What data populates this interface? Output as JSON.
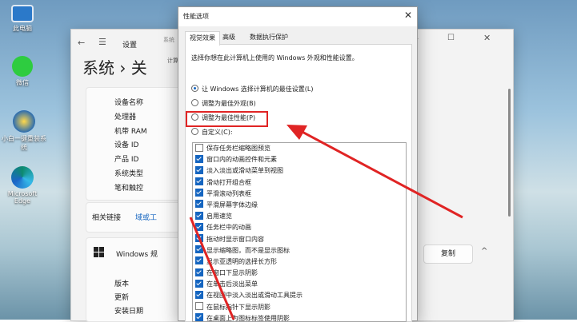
{
  "desktop": {
    "icons": [
      {
        "label": "此电脑",
        "icon": "computer-icon"
      },
      {
        "label": "微信",
        "icon": "wechat-icon"
      },
      {
        "label": "小白一键重装系统",
        "icon": "xiaobai-icon"
      },
      {
        "label": "Microsoft Edge",
        "icon": "edge-icon"
      }
    ]
  },
  "settings": {
    "app_title": "设置",
    "page_title": "系统 › 关",
    "partial_tab": "系统",
    "partial_tab2": "计算",
    "spec_labels": [
      "设备名称",
      "处理器",
      "机带 RAM",
      "设备 ID",
      "产品 ID",
      "系统类型",
      "笔和触控"
    ],
    "related_links_label": "相关链接",
    "related_link": "域或工",
    "windows_spec_label": "Windows 规",
    "copy_button": "复制",
    "win_spec_labels": [
      "版本",
      "更新",
      "安装日期"
    ]
  },
  "dialog": {
    "title": "性能选项",
    "tabs": [
      "视觉效果",
      "高级",
      "数据执行保护"
    ],
    "description": "选择你想在此计算机上使用的 Windows 外观和性能设置。",
    "radios": [
      {
        "label": "让 Windows 选择计算机的最佳设置(L)",
        "checked": true
      },
      {
        "label": "调整为最佳外观(B)",
        "checked": false
      },
      {
        "label": "调整为最佳性能(P)",
        "checked": false,
        "highlighted": true
      },
      {
        "label": "自定义(C):",
        "checked": false
      }
    ],
    "options": [
      {
        "label": "保存任务栏缩略图预览",
        "checked": false
      },
      {
        "label": "窗口内的动画控件和元素",
        "checked": true
      },
      {
        "label": "淡入淡出或滑动菜单到视图",
        "checked": true
      },
      {
        "label": "滑动打开组合框",
        "checked": true
      },
      {
        "label": "平滑滚动列表框",
        "checked": true
      },
      {
        "label": "平滑屏幕字体边缘",
        "checked": true
      },
      {
        "label": "启用速览",
        "checked": true
      },
      {
        "label": "任务栏中的动画",
        "checked": true
      },
      {
        "label": "拖动时显示窗口内容",
        "checked": true
      },
      {
        "label": "显示缩略图，而不是显示图标",
        "checked": true
      },
      {
        "label": "显示亚透明的选择长方形",
        "checked": true
      },
      {
        "label": "在窗口下显示阴影",
        "checked": true
      },
      {
        "label": "在单击后淡出菜单",
        "checked": true
      },
      {
        "label": "在视图中淡入淡出或滑动工具提示",
        "checked": true
      },
      {
        "label": "在鼠标指针下显示阴影",
        "checked": false
      },
      {
        "label": "在桌面上为图标标签使用阴影",
        "checked": true
      }
    ]
  },
  "colors": {
    "accent": "#1565c0",
    "annotation": "#e02424"
  }
}
